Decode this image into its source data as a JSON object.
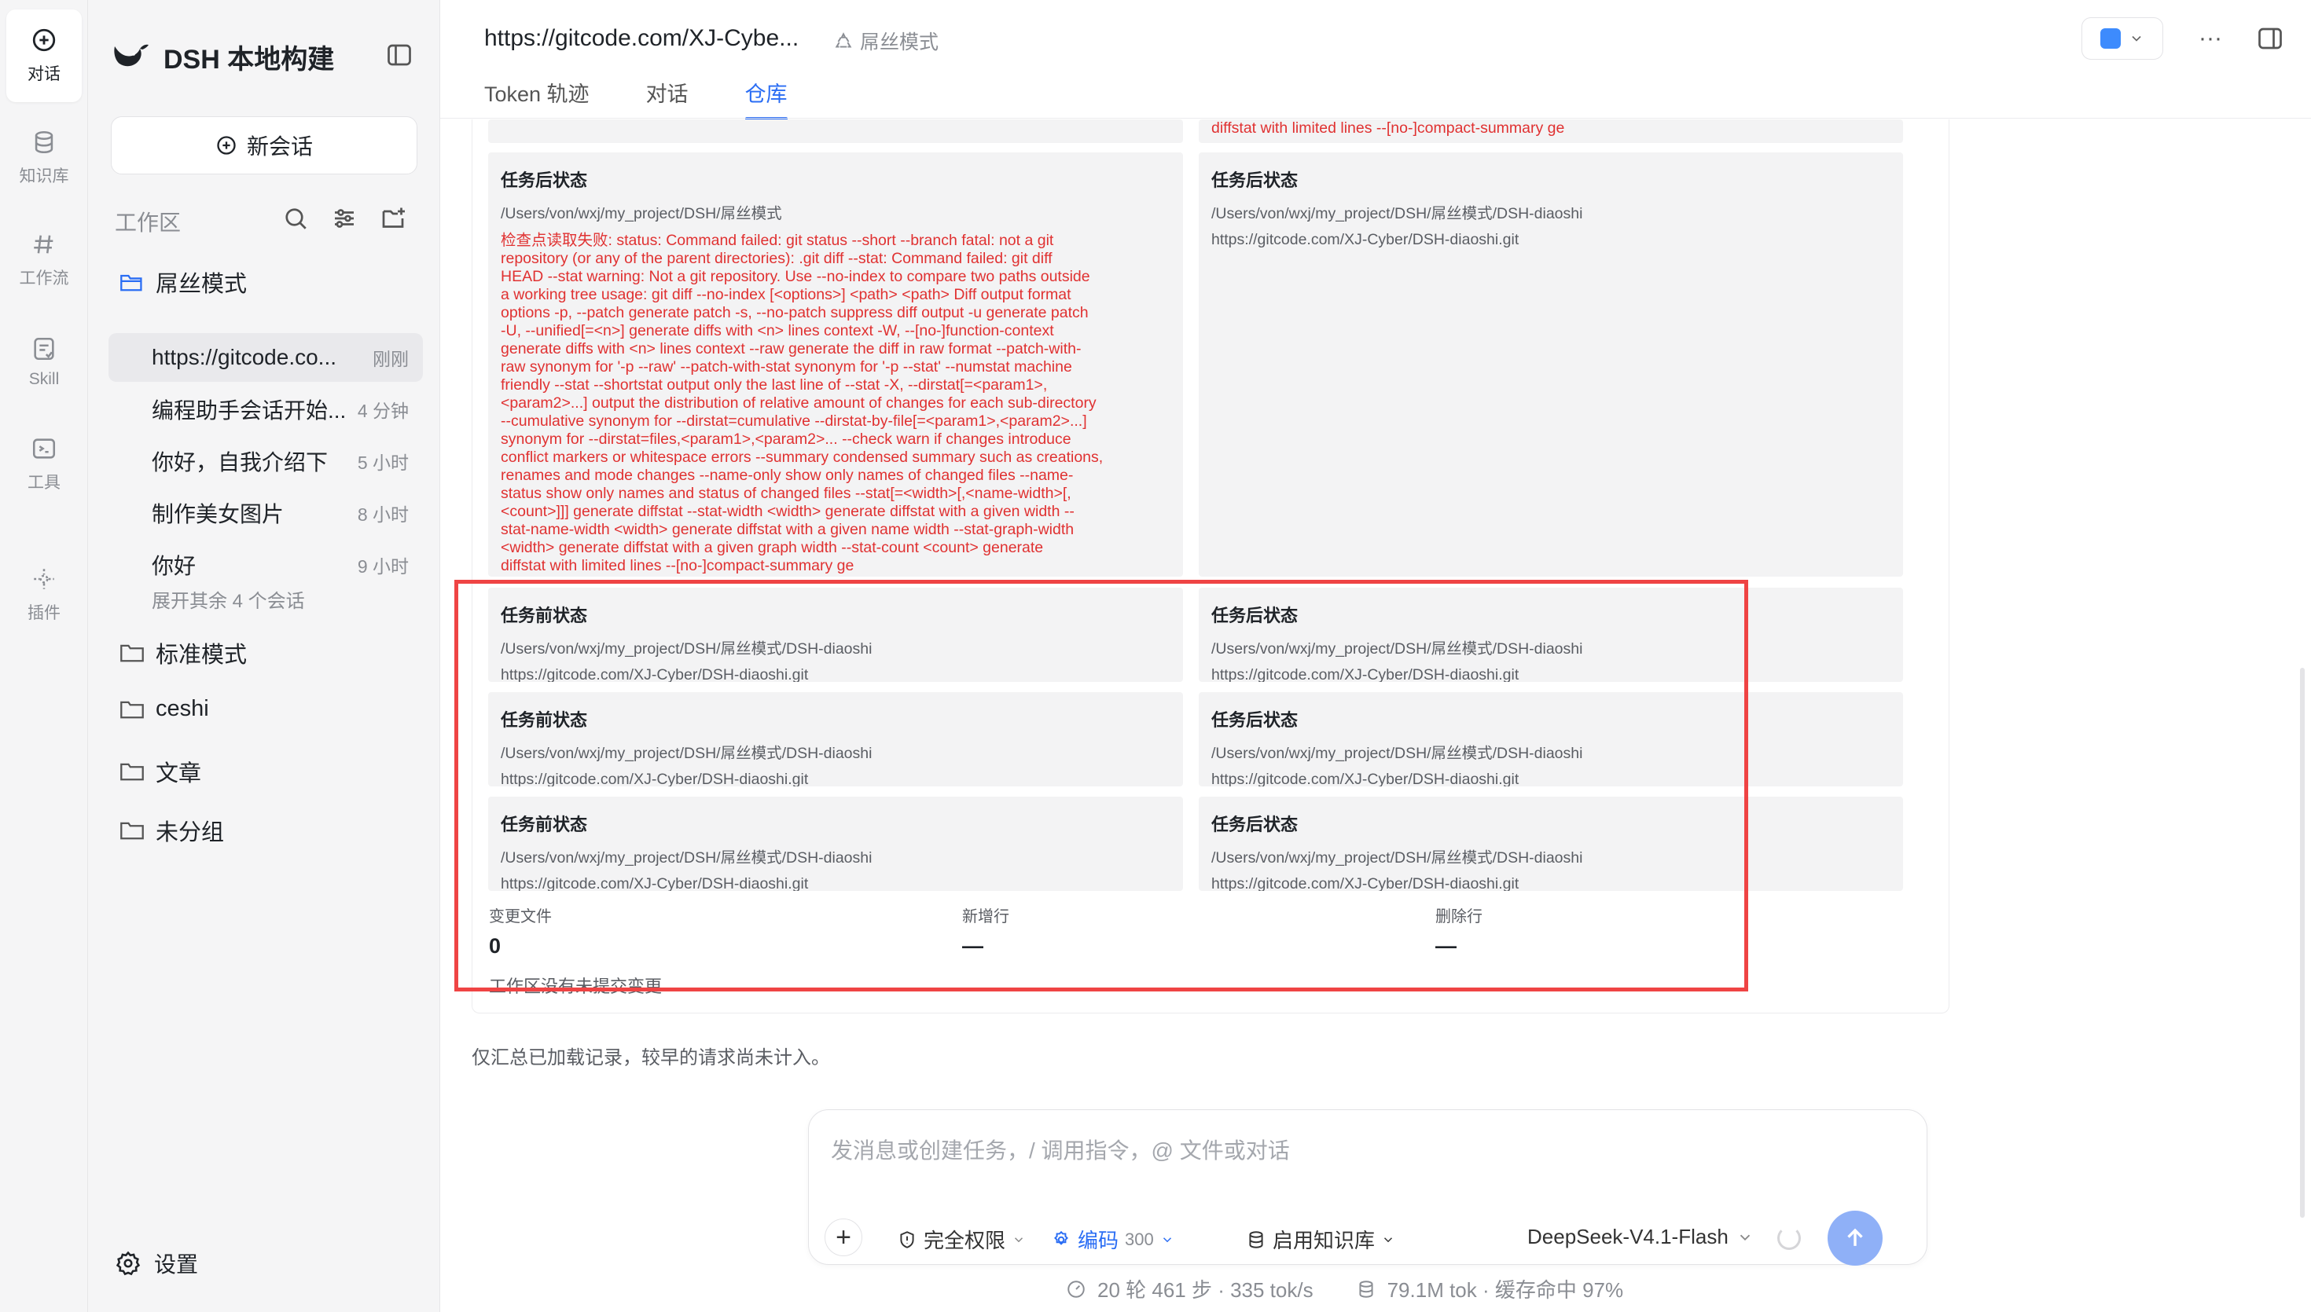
{
  "rail": {
    "items": [
      {
        "label": "对话",
        "icon": "chat-plus-icon",
        "active": true
      },
      {
        "label": "知识库",
        "icon": "database-icon"
      },
      {
        "label": "工作流",
        "icon": "hash-icon"
      },
      {
        "label": "Skill",
        "icon": "skill-icon"
      },
      {
        "label": "工具",
        "icon": "terminal-icon"
      },
      {
        "label": "插件",
        "icon": "plugin-icon"
      }
    ]
  },
  "sidebar": {
    "brand": "DSH 本地构建",
    "new_chat": "新会话",
    "workspace_label": "工作区",
    "folders": [
      {
        "name": "屌丝模式",
        "open": true
      },
      {
        "name": "标准模式"
      },
      {
        "name": "ceshi"
      },
      {
        "name": "文章"
      },
      {
        "name": "未分组"
      }
    ],
    "conversations": [
      {
        "title": "https://gitcode.co...",
        "time": "刚刚",
        "active": true
      },
      {
        "title": "编程助手会话开始...",
        "time": "4 分钟"
      },
      {
        "title": "你好，自我介绍下",
        "time": "5 小时"
      },
      {
        "title": "制作美女图片",
        "time": "8 小时"
      },
      {
        "title": "你好",
        "time": "9 小时"
      }
    ],
    "expand_more": "展开其余 4 个会话",
    "settings": "设置"
  },
  "header": {
    "url": "https://gitcode.com/XJ-Cybe...",
    "mode": "屌丝模式",
    "tabs": [
      "Token 轨迹",
      "对话",
      "仓库"
    ],
    "active_tab": 2
  },
  "repo": {
    "top_right_err": "diffstat with limited lines --[no-]compact-summary ge",
    "big_left": {
      "title": "任务后状态",
      "path": "/Users/von/wxj/my_project/DSH/屌丝模式",
      "error_lines": [
        "检查点读取失败: status: Command failed: git status --short --branch fatal: not a git",
        "repository (or any of the parent directories): .git diff --stat: Command failed: git diff",
        "HEAD --stat warning: Not a git repository. Use --no-index to compare two paths outside",
        "a working tree usage: git diff --no-index [<options>] <path> <path> Diff output format",
        "options -p, --patch generate patch -s, --no-patch suppress diff output -u generate patch",
        "-U, --unified[=<n>] generate diffs with <n> lines context -W, --[no-]function-context",
        "generate diffs with <n> lines context --raw generate the diff in raw format --patch-with-",
        "raw synonym for '-p --raw' --patch-with-stat synonym for '-p --stat' --numstat machine",
        "friendly --stat --shortstat output only the last line of --stat -X, --dirstat[=<param1>,",
        "<param2>...] output the distribution of relative amount of changes for each sub-directory",
        "--cumulative synonym for --dirstat=cumulative --dirstat-by-file[=<param1>,<param2>...]",
        "synonym for --dirstat=files,<param1>,<param2>... --check warn if changes introduce",
        "conflict markers or whitespace errors --summary condensed summary such as creations,",
        "renames and mode changes --name-only show only names of changed files --name-",
        "status show only names and status of changed files --stat[=<width>[,<name-width>[,",
        "<count>]]] generate diffstat --stat-width <width> generate diffstat with a given width --",
        "stat-name-width <width> generate diffstat with a given name width --stat-graph-width",
        "<width> generate diffstat with a given graph width --stat-count <count> generate",
        "diffstat with limited lines --[no-]compact-summary ge"
      ]
    },
    "big_right": {
      "title": "任务后状态",
      "path": "/Users/von/wxj/my_project/DSH/屌丝模式/DSH-diaoshi",
      "url": "https://gitcode.com/XJ-Cyber/DSH-diaoshi.git"
    },
    "rows": [
      {
        "before": {
          "title": "任务前状态",
          "path": "/Users/von/wxj/my_project/DSH/屌丝模式/DSH-diaoshi",
          "url": "https://gitcode.com/XJ-Cyber/DSH-diaoshi.git"
        },
        "after": {
          "title": "任务后状态",
          "path": "/Users/von/wxj/my_project/DSH/屌丝模式/DSH-diaoshi",
          "url": "https://gitcode.com/XJ-Cyber/DSH-diaoshi.git"
        }
      },
      {
        "before": {
          "title": "任务前状态",
          "path": "/Users/von/wxj/my_project/DSH/屌丝模式/DSH-diaoshi",
          "url": "https://gitcode.com/XJ-Cyber/DSH-diaoshi.git"
        },
        "after": {
          "title": "任务后状态",
          "path": "/Users/von/wxj/my_project/DSH/屌丝模式/DSH-diaoshi",
          "url": "https://gitcode.com/XJ-Cyber/DSH-diaoshi.git"
        }
      },
      {
        "before": {
          "title": "任务前状态",
          "path": "/Users/von/wxj/my_project/DSH/屌丝模式/DSH-diaoshi",
          "url": "https://gitcode.com/XJ-Cyber/DSH-diaoshi.git"
        },
        "after": {
          "title": "任务后状态",
          "path": "/Users/von/wxj/my_project/DSH/屌丝模式/DSH-diaoshi",
          "url": "https://gitcode.com/XJ-Cyber/DSH-diaoshi.git"
        }
      }
    ],
    "stats": [
      {
        "label": "变更文件",
        "value": "0"
      },
      {
        "label": "新增行",
        "value": "—"
      },
      {
        "label": "删除行",
        "value": "—"
      }
    ],
    "uncommitted": "工作区没有未提交变更"
  },
  "footnote": "仅汇总已加载记录，较早的请求尚未计入。",
  "composer": {
    "placeholder": "发消息或创建任务，/ 调用指令，@ 文件或对话",
    "permission": "完全权限",
    "code_label": "编码",
    "code_count": "300",
    "knowledge": "启用知识库",
    "model": "DeepSeek-V4.1-Flash"
  },
  "status_bar": {
    "turns": "20 轮 461 步 · 335 tok/s",
    "tokens": "79.1M tok · 缓存命中 97%"
  },
  "colors": {
    "accent": "#2a6df4",
    "error": "#e03131",
    "highlight": "#ef4444"
  }
}
